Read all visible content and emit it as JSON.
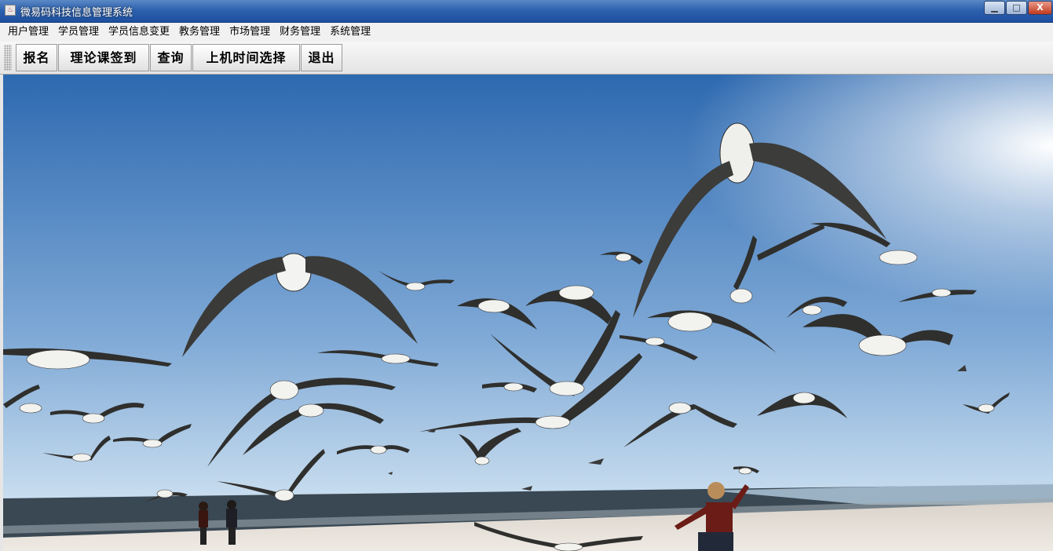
{
  "window": {
    "title": "微易码科技信息管理系统",
    "minimize_glyph": "▁",
    "maximize_glyph": "□",
    "close_glyph": "X"
  },
  "menu": [
    {
      "label": "用户管理"
    },
    {
      "label": "学员管理"
    },
    {
      "label": "学员信息变更"
    },
    {
      "label": "教务管理"
    },
    {
      "label": "市场管理"
    },
    {
      "label": "财务管理"
    },
    {
      "label": "系统管理"
    }
  ],
  "toolbar": [
    {
      "label": "报名"
    },
    {
      "label": "理论课签到"
    },
    {
      "label": "查询"
    },
    {
      "label": "上机时间选择"
    },
    {
      "label": "退出"
    }
  ],
  "background": {
    "scene": "seagulls-over-beach",
    "sky_top": "#2f6fb6",
    "sky_bottom": "#c9dff0",
    "sea": "#3b4a55",
    "sand": "#e9e4dc"
  }
}
